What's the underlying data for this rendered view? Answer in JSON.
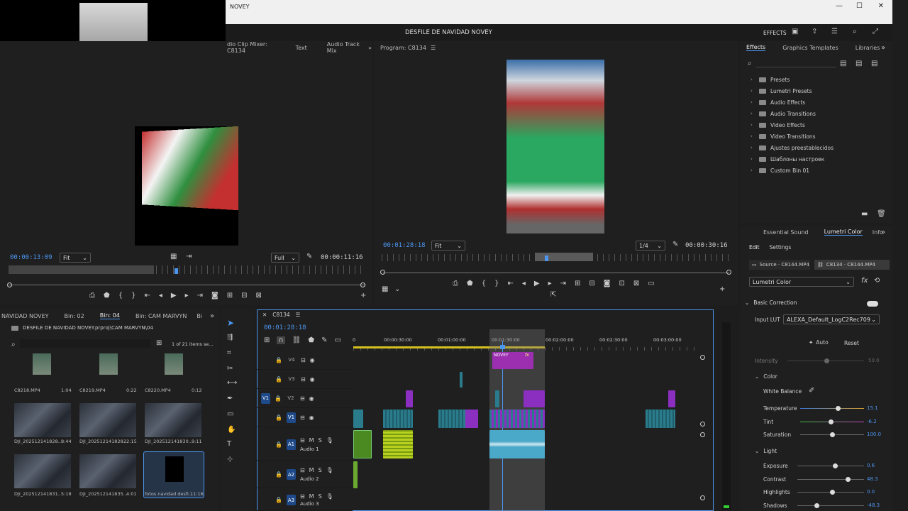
{
  "window": {
    "title": "NOVEY",
    "min": "—",
    "max": "☐",
    "close": "✕"
  },
  "appbar": {
    "project_title": "DESFILE DE NAVIDAD NOVEY",
    "workspace": "EFFECTS"
  },
  "source_panel": {
    "tabs": [
      "dio Clip Mixer: C8134",
      "Text",
      "Audio Track Mix"
    ],
    "timecode_in": "00:00:13:09",
    "fit": "Fit",
    "quality": "Full",
    "timecode_dur": "00:00:11:16"
  },
  "program_panel": {
    "tab": "Program: C8134",
    "timecode": "00:01:28:18",
    "fit": "Fit",
    "quality": "1/4",
    "duration": "00:00:30:16"
  },
  "effects_panel": {
    "tabs": [
      "Effects",
      "Graphics Templates",
      "Libraries"
    ],
    "items": [
      "Presets",
      "Lumetri Presets",
      "Audio Effects",
      "Audio Transitions",
      "Video Effects",
      "Video Transitions",
      "Ajustes preestablecidos",
      "Шаблоны настроек",
      "Custom Bin 01"
    ]
  },
  "lumetri": {
    "tabs": [
      "Essential Sound",
      "Lumetri Color",
      "Info"
    ],
    "subtabs": [
      "Edit",
      "Settings"
    ],
    "source_clip": "Source · C8144.MP4",
    "seq_clip": "C8134 · C8144.MP4",
    "effect": "Lumetri Color",
    "basic_correction": "Basic Correction",
    "input_lut_label": "Input LUT",
    "input_lut": "ALEXA_Default_LogC2Rec709",
    "auto": "Auto",
    "reset": "Reset",
    "intensity": {
      "label": "Intensity",
      "value": "50.0"
    },
    "color": "Color",
    "white_balance": "White Balance",
    "params": [
      {
        "label": "Temperature",
        "value": "15.1"
      },
      {
        "label": "Tint",
        "value": "-6.2"
      },
      {
        "label": "Saturation",
        "value": "100.0"
      }
    ],
    "light": "Light",
    "light_params": [
      {
        "label": "Exposure",
        "value": "0.6"
      },
      {
        "label": "Contrast",
        "value": "48.3"
      },
      {
        "label": "Highlights",
        "value": "0.0"
      },
      {
        "label": "Shadows",
        "value": "-48.3"
      }
    ]
  },
  "project": {
    "tabs": [
      "NAVIDAD NOVEY",
      "Bin: 02",
      "Bin: 04",
      "Bin: CAM MARVYN",
      "Bi"
    ],
    "path": "DESFILE DE NAVIDAD NOVEY.prproj\\CAM MARVYN\\04",
    "count": "1 of 21 items se...",
    "items": [
      {
        "name": "C8218.MP4",
        "dur": "1:04"
      },
      {
        "name": "C8219.MP4",
        "dur": "0:22"
      },
      {
        "name": "C8220.MP4",
        "dur": "0:12"
      },
      {
        "name": "DJI_202512141828...",
        "dur": "8:44"
      },
      {
        "name": "DJI_202512141828...",
        "dur": "22:15"
      },
      {
        "name": "DJI_202512141830...",
        "dur": "9:11"
      },
      {
        "name": "DJI_202512141831...",
        "dur": "5:18"
      },
      {
        "name": "DJI_202512141835...",
        "dur": "4:01"
      },
      {
        "name": "fotos navidad desfi...",
        "dur": "11:16"
      }
    ]
  },
  "timeline": {
    "sequence": "C8134",
    "timecode": "00:01:28:18",
    "ruler": [
      "0",
      "00:00:30:00",
      "00:01:00:00",
      "00:01:30:00",
      "00:02:00:00",
      "00:02:30:00",
      "00:03:00:00"
    ],
    "tracks": [
      {
        "id": "V4",
        "name": ""
      },
      {
        "id": "V3",
        "name": ""
      },
      {
        "id": "V2",
        "name": ""
      },
      {
        "id": "V1",
        "name": ""
      },
      {
        "id": "A1",
        "name": "Audio 1"
      },
      {
        "id": "A2",
        "name": "Audio 2"
      },
      {
        "id": "A3",
        "name": "Audio 3"
      }
    ],
    "v1_patch": "V1",
    "title_clip": "NOVEY",
    "fx": "fx"
  }
}
